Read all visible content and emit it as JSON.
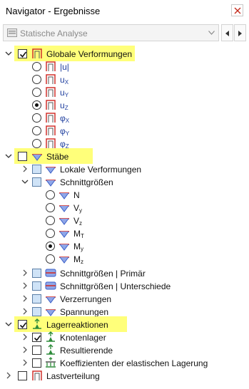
{
  "window": {
    "title": "Navigator - Ergebnisse"
  },
  "toolbar": {
    "combo_value": "Statische Analyse"
  },
  "colors": {
    "highlight": "#ffff7a",
    "member_icon_red": "#d0302b",
    "member_icon_blue": "#3a5fc8"
  },
  "tree": {
    "globale": {
      "label": "Globale Verformungen",
      "checked": true
    },
    "global_items": [
      {
        "main": "|u|",
        "sub": "",
        "selected": false
      },
      {
        "main": "u",
        "sub": "X",
        "selected": false
      },
      {
        "main": "u",
        "sub": "Y",
        "selected": false
      },
      {
        "main": "u",
        "sub": "Z",
        "selected": true
      },
      {
        "main": "φ",
        "sub": "X",
        "selected": false
      },
      {
        "main": "φ",
        "sub": "Y",
        "selected": false
      },
      {
        "main": "φ",
        "sub": "Z",
        "selected": false
      }
    ],
    "staebe": {
      "label": "Stäbe",
      "checked": false
    },
    "lokale": {
      "label": "Lokale Verformungen"
    },
    "schnitt": {
      "label": "Schnittgrößen"
    },
    "schnitt_items": [
      {
        "main": "N",
        "sub": "",
        "selected": false
      },
      {
        "main": "V",
        "sub": "y",
        "selected": false
      },
      {
        "main": "V",
        "sub": "z",
        "selected": false
      },
      {
        "main": "M",
        "sub": "T",
        "selected": false
      },
      {
        "main": "M",
        "sub": "y",
        "selected": true
      },
      {
        "main": "M",
        "sub": "z",
        "selected": false
      }
    ],
    "schnitt_primaer": {
      "label": "Schnittgrößen | Primär"
    },
    "schnitt_unterschiede": {
      "label": "Schnittgrößen | Unterschiede"
    },
    "verzerrungen": {
      "label": "Verzerrungen"
    },
    "spannungen": {
      "label": "Spannungen"
    },
    "lager": {
      "label": "Lagerreaktionen",
      "checked": true
    },
    "knotenlager": {
      "label": "Knotenlager",
      "checked": true
    },
    "resultierende": {
      "label": "Resultierende",
      "checked": false
    },
    "koeffizienten": {
      "label": "Koeffizienten der elastischen Lagerung",
      "checked": false
    },
    "lastverteilung": {
      "label": "Lastverteilung",
      "checked": false
    }
  }
}
